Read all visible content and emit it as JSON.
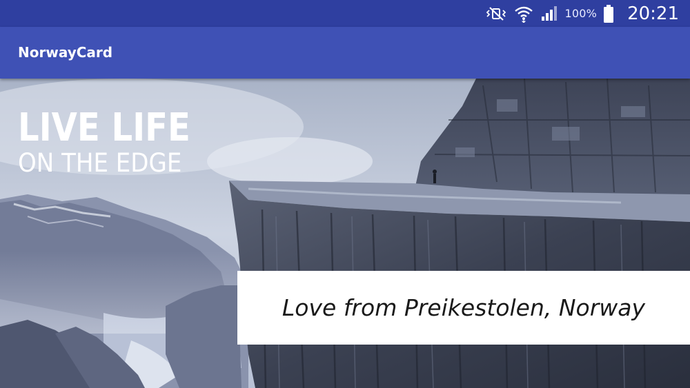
{
  "status_bar": {
    "icons": [
      "mute-vibrate-icon",
      "wifi-icon",
      "signal-icon",
      "battery-icon"
    ],
    "battery_percent": "100%",
    "time": "20:21"
  },
  "app_bar": {
    "title": "NorwayCard"
  },
  "card": {
    "headline_line1": "LIVE LIFE",
    "headline_line2": "ON THE EDGE",
    "caption": "Love from Preikestolen, Norway"
  },
  "colors": {
    "status_bar": "#2f3fa0",
    "app_bar": "#3f51b5",
    "caption_background": "#ffffff"
  }
}
